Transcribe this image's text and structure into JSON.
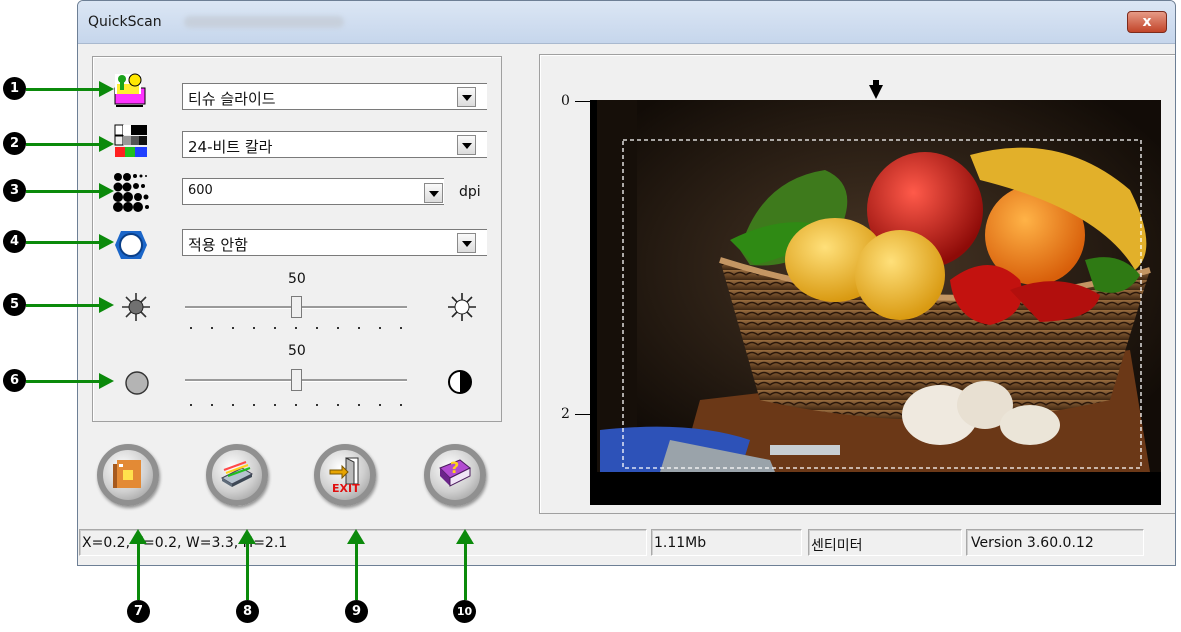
{
  "window": {
    "title": "QuickScan",
    "close_label": "x"
  },
  "settings": {
    "scan_type": "티슈 슬라이드",
    "color_mode": "24-비트 칼라",
    "resolution": "600",
    "resolution_unit": "dpi",
    "filter": "적용 안함",
    "brightness": {
      "value_label": "50",
      "value": 50,
      "min": 0,
      "max": 100
    },
    "contrast": {
      "value_label": "50",
      "value": 50,
      "min": 0,
      "max": 100
    }
  },
  "callouts": [
    "1",
    "2",
    "3",
    "4",
    "5",
    "6",
    "7",
    "8",
    "9",
    "10"
  ],
  "buttons": [
    {
      "name": "scan-button",
      "icon": "scan-folder-icon"
    },
    {
      "name": "preview-button",
      "icon": "scanner-icon"
    },
    {
      "name": "exit-button",
      "icon": "exit-door-icon",
      "label": "EXIT"
    },
    {
      "name": "help-button",
      "icon": "help-book-icon",
      "label": "?"
    }
  ],
  "preview": {
    "ruler_top": "0",
    "ruler_bottom": "2"
  },
  "statusbar": {
    "coords": "X=0.2, Y=0.2, W=3.3, H=2.1",
    "size": "1.11Mb",
    "unit": "센티미터",
    "version": "Version 3.60.0.12"
  },
  "colors": {
    "callout_arrow": "#0b8a0b",
    "close_button": "#c2452a"
  }
}
